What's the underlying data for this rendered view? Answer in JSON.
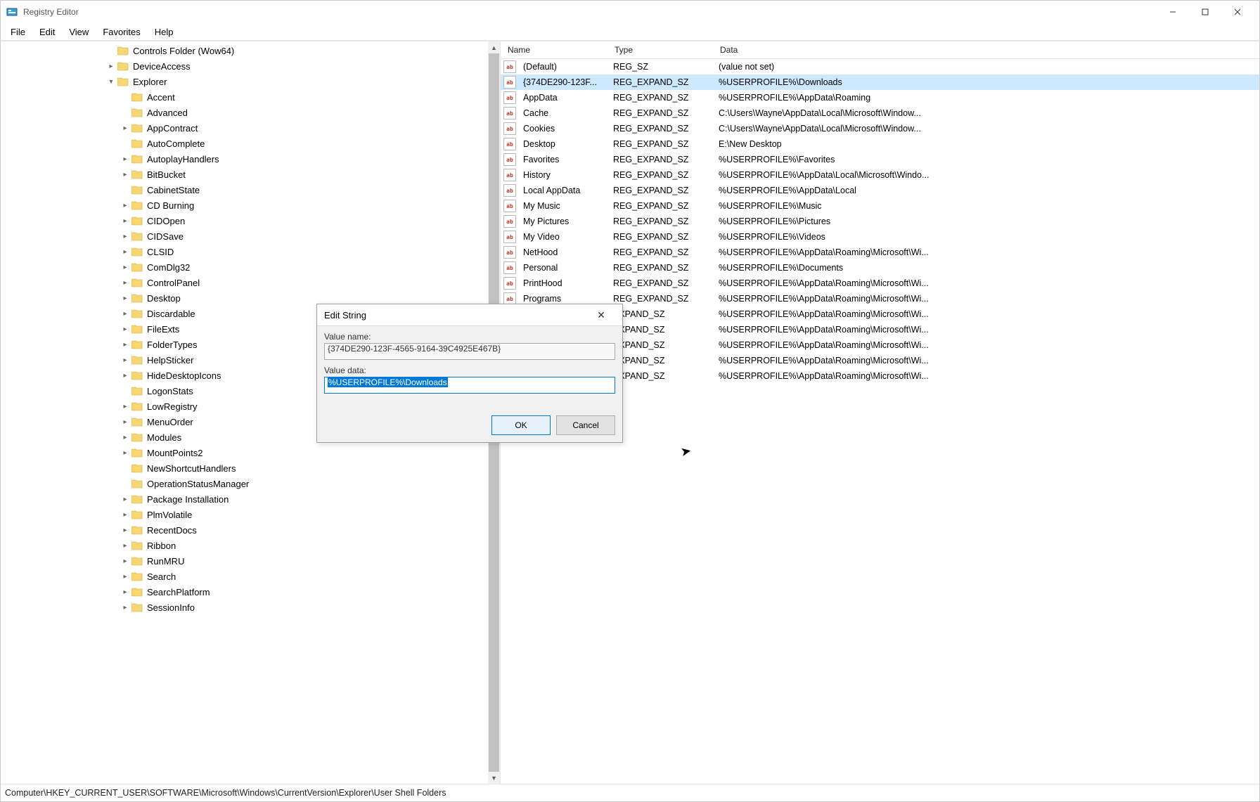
{
  "title": "Registry Editor",
  "menu": [
    "File",
    "Edit",
    "View",
    "Favorites",
    "Help"
  ],
  "tree": [
    {
      "indent": 150,
      "exp": "",
      "label": "Controls Folder (Wow64)"
    },
    {
      "indent": 150,
      "exp": ">",
      "label": "DeviceAccess"
    },
    {
      "indent": 150,
      "exp": "v",
      "label": "Explorer"
    },
    {
      "indent": 170,
      "exp": "",
      "label": "Accent"
    },
    {
      "indent": 170,
      "exp": "",
      "label": "Advanced"
    },
    {
      "indent": 170,
      "exp": ">",
      "label": "AppContract"
    },
    {
      "indent": 170,
      "exp": "",
      "label": "AutoComplete"
    },
    {
      "indent": 170,
      "exp": ">",
      "label": "AutoplayHandlers"
    },
    {
      "indent": 170,
      "exp": ">",
      "label": "BitBucket"
    },
    {
      "indent": 170,
      "exp": "",
      "label": "CabinetState"
    },
    {
      "indent": 170,
      "exp": ">",
      "label": "CD Burning"
    },
    {
      "indent": 170,
      "exp": ">",
      "label": "CIDOpen"
    },
    {
      "indent": 170,
      "exp": ">",
      "label": "CIDSave"
    },
    {
      "indent": 170,
      "exp": ">",
      "label": "CLSID"
    },
    {
      "indent": 170,
      "exp": ">",
      "label": "ComDlg32"
    },
    {
      "indent": 170,
      "exp": ">",
      "label": "ControlPanel"
    },
    {
      "indent": 170,
      "exp": ">",
      "label": "Desktop"
    },
    {
      "indent": 170,
      "exp": ">",
      "label": "Discardable"
    },
    {
      "indent": 170,
      "exp": ">",
      "label": "FileExts"
    },
    {
      "indent": 170,
      "exp": ">",
      "label": "FolderTypes"
    },
    {
      "indent": 170,
      "exp": ">",
      "label": "HelpSticker"
    },
    {
      "indent": 170,
      "exp": ">",
      "label": "HideDesktopIcons"
    },
    {
      "indent": 170,
      "exp": "",
      "label": "LogonStats"
    },
    {
      "indent": 170,
      "exp": ">",
      "label": "LowRegistry"
    },
    {
      "indent": 170,
      "exp": ">",
      "label": "MenuOrder"
    },
    {
      "indent": 170,
      "exp": ">",
      "label": "Modules"
    },
    {
      "indent": 170,
      "exp": ">",
      "label": "MountPoints2"
    },
    {
      "indent": 170,
      "exp": "",
      "label": "NewShortcutHandlers"
    },
    {
      "indent": 170,
      "exp": "",
      "label": "OperationStatusManager"
    },
    {
      "indent": 170,
      "exp": ">",
      "label": "Package Installation"
    },
    {
      "indent": 170,
      "exp": ">",
      "label": "PlmVolatile"
    },
    {
      "indent": 170,
      "exp": ">",
      "label": "RecentDocs"
    },
    {
      "indent": 170,
      "exp": ">",
      "label": "Ribbon"
    },
    {
      "indent": 170,
      "exp": ">",
      "label": "RunMRU"
    },
    {
      "indent": 170,
      "exp": ">",
      "label": "Search"
    },
    {
      "indent": 170,
      "exp": ">",
      "label": "SearchPlatform"
    },
    {
      "indent": 170,
      "exp": ">",
      "label": "SessionInfo"
    }
  ],
  "list_headers": {
    "name": "Name",
    "type": "Type",
    "data": "Data"
  },
  "list_rows": [
    {
      "name": "(Default)",
      "type": "REG_SZ",
      "data": "(value not set)",
      "sel": false
    },
    {
      "name": "{374DE290-123F...",
      "type": "REG_EXPAND_SZ",
      "data": "%USERPROFILE%\\Downloads",
      "sel": true
    },
    {
      "name": "AppData",
      "type": "REG_EXPAND_SZ",
      "data": "%USERPROFILE%\\AppData\\Roaming",
      "sel": false
    },
    {
      "name": "Cache",
      "type": "REG_EXPAND_SZ",
      "data": "C:\\Users\\Wayne\\AppData\\Local\\Microsoft\\Window...",
      "sel": false
    },
    {
      "name": "Cookies",
      "type": "REG_EXPAND_SZ",
      "data": "C:\\Users\\Wayne\\AppData\\Local\\Microsoft\\Window...",
      "sel": false
    },
    {
      "name": "Desktop",
      "type": "REG_EXPAND_SZ",
      "data": "E:\\New Desktop",
      "sel": false
    },
    {
      "name": "Favorites",
      "type": "REG_EXPAND_SZ",
      "data": "%USERPROFILE%\\Favorites",
      "sel": false
    },
    {
      "name": "History",
      "type": "REG_EXPAND_SZ",
      "data": "%USERPROFILE%\\AppData\\Local\\Microsoft\\Windo...",
      "sel": false
    },
    {
      "name": "Local AppData",
      "type": "REG_EXPAND_SZ",
      "data": "%USERPROFILE%\\AppData\\Local",
      "sel": false
    },
    {
      "name": "My Music",
      "type": "REG_EXPAND_SZ",
      "data": "%USERPROFILE%\\Music",
      "sel": false
    },
    {
      "name": "My Pictures",
      "type": "REG_EXPAND_SZ",
      "data": "%USERPROFILE%\\Pictures",
      "sel": false
    },
    {
      "name": "My Video",
      "type": "REG_EXPAND_SZ",
      "data": "%USERPROFILE%\\Videos",
      "sel": false
    },
    {
      "name": "NetHood",
      "type": "REG_EXPAND_SZ",
      "data": "%USERPROFILE%\\AppData\\Roaming\\Microsoft\\Wi...",
      "sel": false
    },
    {
      "name": "Personal",
      "type": "REG_EXPAND_SZ",
      "data": "%USERPROFILE%\\Documents",
      "sel": false
    },
    {
      "name": "PrintHood",
      "type": "REG_EXPAND_SZ",
      "data": "%USERPROFILE%\\AppData\\Roaming\\Microsoft\\Wi...",
      "sel": false
    },
    {
      "name": "Programs",
      "type": "REG_EXPAND_SZ",
      "data": "%USERPROFILE%\\AppData\\Roaming\\Microsoft\\Wi...",
      "sel": false
    },
    {
      "name": "",
      "type": "EXPAND_SZ",
      "data": "%USERPROFILE%\\AppData\\Roaming\\Microsoft\\Wi...",
      "sel": false
    },
    {
      "name": "",
      "type": "EXPAND_SZ",
      "data": "%USERPROFILE%\\AppData\\Roaming\\Microsoft\\Wi...",
      "sel": false
    },
    {
      "name": "",
      "type": "EXPAND_SZ",
      "data": "%USERPROFILE%\\AppData\\Roaming\\Microsoft\\Wi...",
      "sel": false
    },
    {
      "name": "",
      "type": "EXPAND_SZ",
      "data": "%USERPROFILE%\\AppData\\Roaming\\Microsoft\\Wi...",
      "sel": false
    },
    {
      "name": "",
      "type": "EXPAND_SZ",
      "data": "%USERPROFILE%\\AppData\\Roaming\\Microsoft\\Wi...",
      "sel": false
    }
  ],
  "dialog": {
    "title": "Edit String",
    "value_name_label": "Value name:",
    "value_name": "{374DE290-123F-4565-9164-39C4925E467B}",
    "value_data_label": "Value data:",
    "value_data": "%USERPROFILE%\\Downloads",
    "ok": "OK",
    "cancel": "Cancel"
  },
  "status": "Computer\\HKEY_CURRENT_USER\\SOFTWARE\\Microsoft\\Windows\\CurrentVersion\\Explorer\\User Shell Folders"
}
